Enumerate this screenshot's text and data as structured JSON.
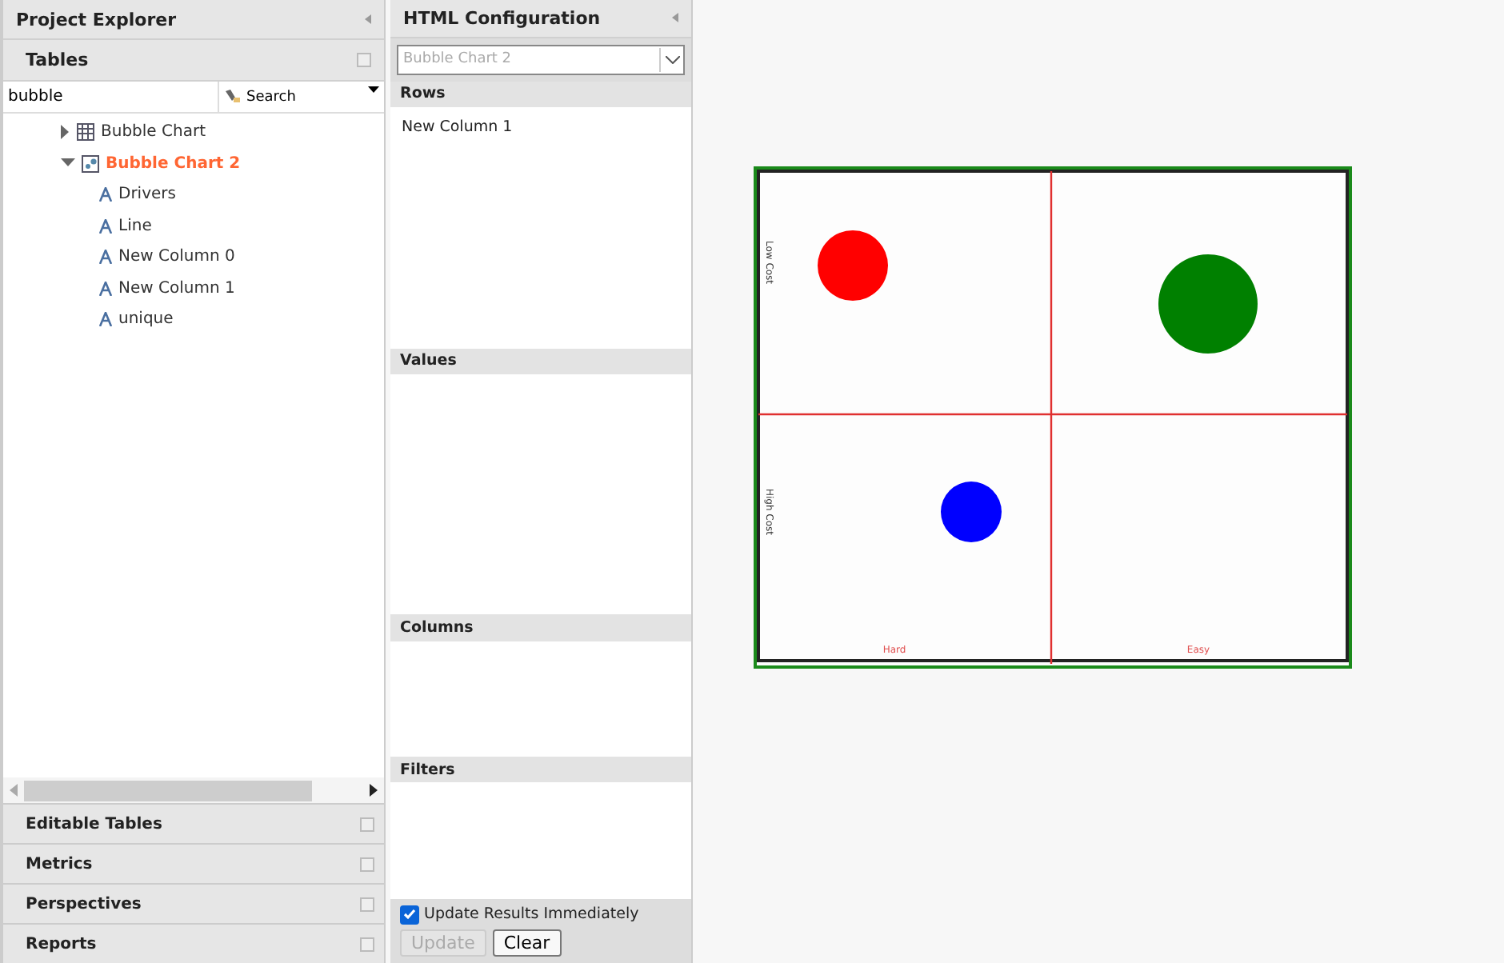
{
  "explorer": {
    "title": "Project Explorer",
    "section": "Tables",
    "search": {
      "value": "bubble",
      "button": "Search"
    },
    "tree": [
      {
        "label": "Bubble Chart",
        "kind": "table",
        "expanded": false,
        "selected": false
      },
      {
        "label": "Bubble Chart 2",
        "kind": "chart",
        "expanded": true,
        "selected": true,
        "children": [
          {
            "label": "Drivers",
            "kind": "column",
            "selected": false
          },
          {
            "label": "Line",
            "kind": "column",
            "selected": false
          },
          {
            "label": "New Column 0",
            "kind": "column",
            "selected": false
          },
          {
            "label": "New Column 1",
            "kind": "column",
            "selected": false
          },
          {
            "label": "unique",
            "kind": "column",
            "selected": false
          }
        ]
      }
    ],
    "sections": [
      "Editable Tables",
      "Metrics",
      "Perspectives",
      "Reports"
    ]
  },
  "config": {
    "title": "HTML Configuration",
    "dropdown": {
      "value": "Bubble Chart 2"
    },
    "zones": [
      {
        "title": "Rows",
        "items": [
          "New Column 1"
        ]
      },
      {
        "title": "Values"
      },
      {
        "title": "Columns"
      },
      {
        "title": "Filters"
      }
    ],
    "update_immediately": {
      "label": "Update Results Immediately",
      "checked": true
    },
    "buttons": [
      {
        "label": "Update",
        "disabled": true
      },
      {
        "label": "Clear",
        "disabled": false
      }
    ]
  },
  "preview": {
    "y_labels": [
      "Low Cost",
      "High Cost"
    ],
    "x_labels": [
      "Hard",
      "Easy"
    ],
    "bubbles": [
      {
        "color": "#ff0000"
      },
      {
        "color": "#008000"
      },
      {
        "color": "#0000ff"
      }
    ]
  }
}
